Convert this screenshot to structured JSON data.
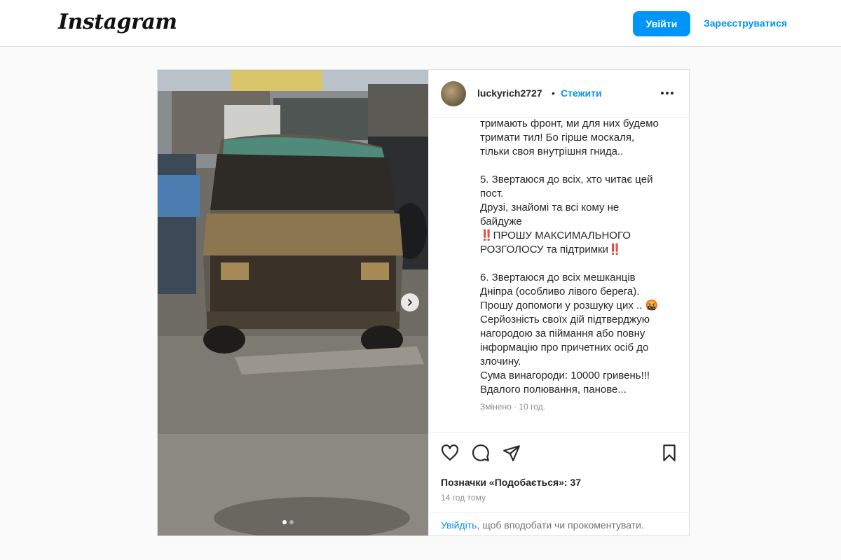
{
  "app": {
    "logo": "Instagram"
  },
  "header": {
    "login_label": "Увійти",
    "signup_label": "Зареєструватися"
  },
  "post": {
    "username": "luckyrich2727",
    "separator": "•",
    "follow_label": "Стежити",
    "caption": "тримають фронт, ми для них будемо\nтримати тил! Бо гірше москаля,\nтільки своя внутрішня гнида..\n\n5. Звертаюся до всіх, хто читає цей\nпост.\nДрузі, знайомі та всі кому не\nбайдуже\n‼️ПРОШУ МАКСИМАЛЬНОГО\nРОЗГОЛОСУ та підтримки‼️\n\n6. Звертаюся до всіх мешканців\nДніпра (особливо лівого берега).\nПрошу допомоги у розшуку цих .. 🤬\nСерйозність своїх дій підтверджую\nнагородою за піймання або повну\nінформацію про причетних осіб до\nзлочину.\nСума винагороди: 10000 гривень!!!\nВдалого полювання, панове...",
    "edited_label": "Змінено · 10 год.",
    "likes_label": "Позначки «Подобається»: 37",
    "time_label": "14 год тому",
    "login_prompt_link": "Увійдіть",
    "login_prompt_rest": ", щоб вподобати чи прокоментувати."
  },
  "carousel": {
    "slide_count": 2,
    "active_index": 0
  },
  "icons": {
    "like": "heart-icon",
    "comment": "comment-icon",
    "share": "send-icon",
    "save": "bookmark-icon",
    "more": "more-horizontal-icon",
    "next": "chevron-right-icon"
  },
  "colors": {
    "accent": "#0095f6",
    "text": "#262626",
    "muted": "#8e8e8e",
    "border": "#dbdbdb"
  }
}
